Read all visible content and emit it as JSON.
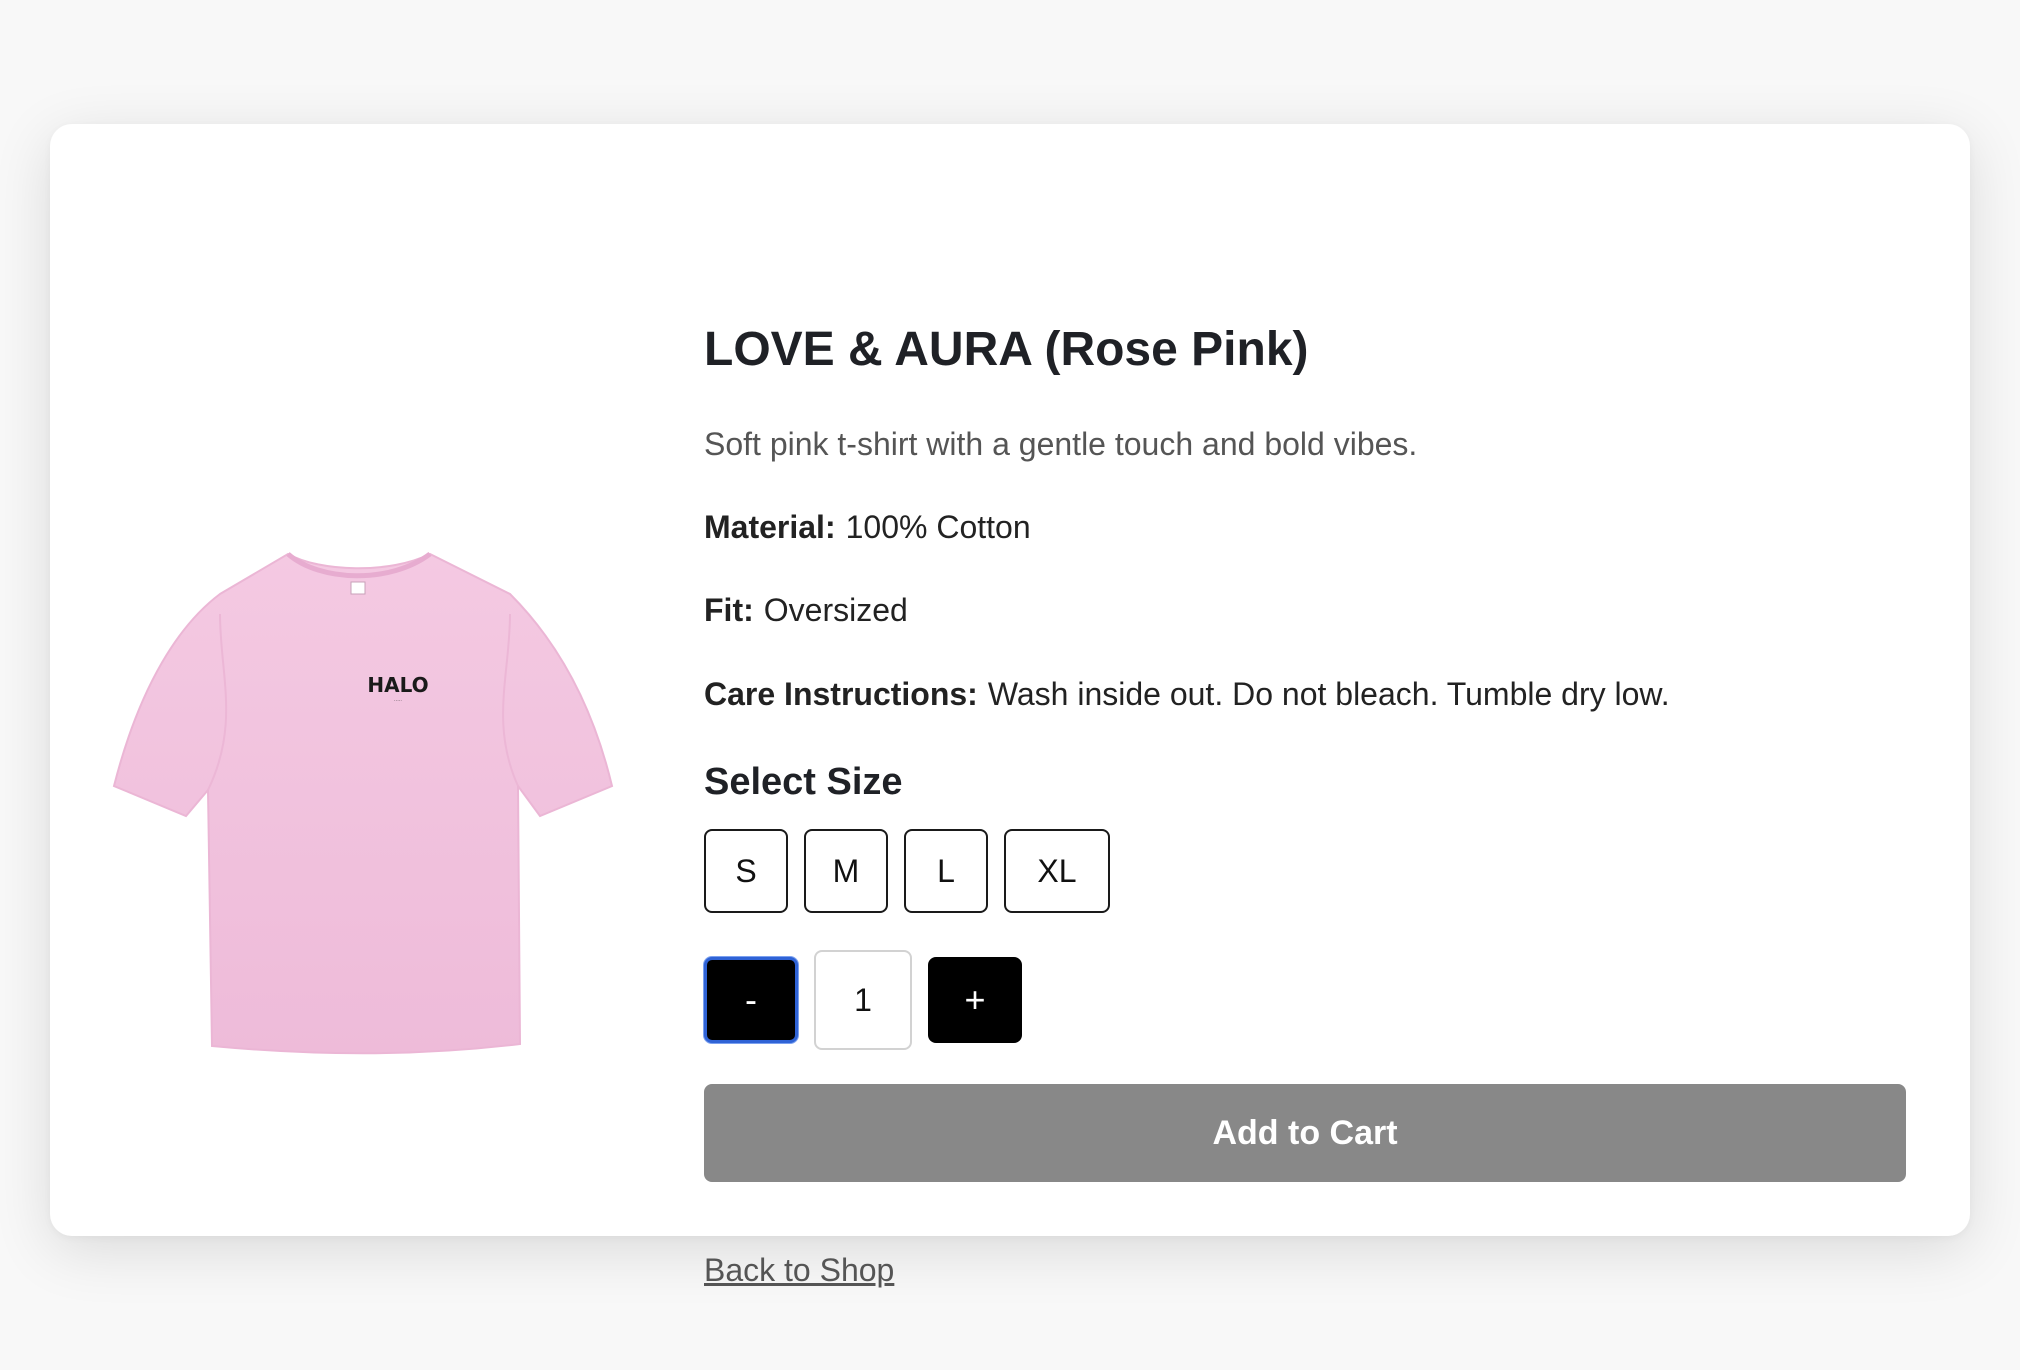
{
  "product": {
    "title": "LOVE & AURA (Rose Pink)",
    "description": "Soft pink t-shirt with a gentle touch and bold vibes.",
    "image_brand_text": "HALO",
    "specs": {
      "material_label": "Material:",
      "material_value": "100% Cotton",
      "fit_label": "Fit:",
      "fit_value": "Oversized",
      "care_label": "Care Instructions:",
      "care_value": "Wash inside out. Do not bleach. Tumble dry low."
    }
  },
  "size_selector": {
    "heading": "Select Size",
    "options": [
      "S",
      "M",
      "L",
      "XL"
    ]
  },
  "quantity": {
    "minus_label": "-",
    "value": "1",
    "plus_label": "+"
  },
  "actions": {
    "add_to_cart_label": "Add to Cart",
    "back_link_label": "Back to Shop"
  },
  "colors": {
    "page_bg": "#f8f8f8",
    "card_bg": "#ffffff",
    "shirt_pink": "#f2c3df",
    "button_black": "#000000",
    "add_to_cart_bg": "#888888",
    "focus_ring": "#2f63d6"
  }
}
